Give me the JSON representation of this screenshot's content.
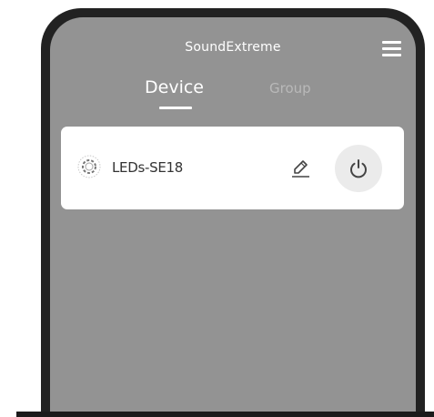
{
  "header": {
    "app_title": "SoundExtreme",
    "menu_icon": "hamburger-menu-icon"
  },
  "tabs": [
    {
      "label": "Device",
      "active": true
    },
    {
      "label": "Group",
      "active": false
    }
  ],
  "devices": [
    {
      "name": "LEDs-SE18",
      "icon": "loading-spinner-icon",
      "actions": [
        "edit-pencil-icon",
        "power-icon"
      ]
    }
  ],
  "colors": {
    "phone_frame": "#222222",
    "screen_background": "#939393",
    "card_background": "#ffffff",
    "active_tab": "#ffffff",
    "inactive_tab": "#b9b9b9",
    "power_button_bg": "#ebebeb"
  }
}
